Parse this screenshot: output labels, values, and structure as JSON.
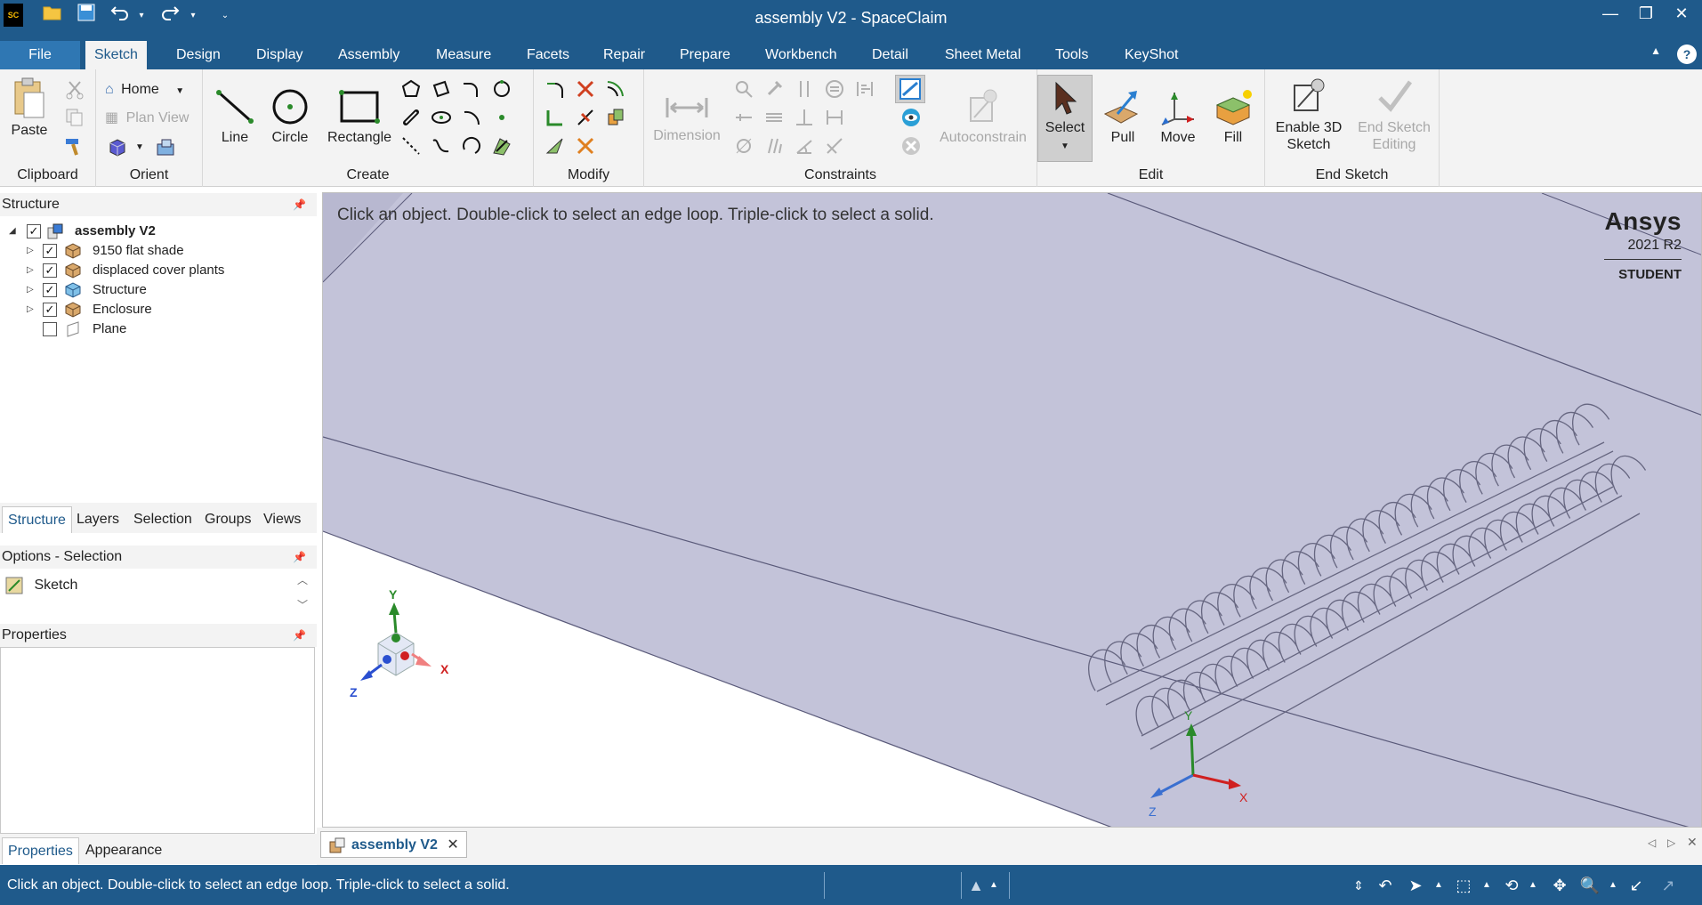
{
  "app": {
    "title": "assembly V2 - SpaceClaim",
    "logo_text": "SC"
  },
  "quick_access": [
    "open-icon",
    "save-icon",
    "undo-icon",
    "redo-icon",
    "customize-icon"
  ],
  "tabs": [
    {
      "label": "File"
    },
    {
      "label": "Sketch"
    },
    {
      "label": "Design"
    },
    {
      "label": "Display"
    },
    {
      "label": "Assembly"
    },
    {
      "label": "Measure"
    },
    {
      "label": "Facets"
    },
    {
      "label": "Repair"
    },
    {
      "label": "Prepare"
    },
    {
      "label": "Workbench"
    },
    {
      "label": "Detail"
    },
    {
      "label": "Sheet Metal"
    },
    {
      "label": "Tools"
    },
    {
      "label": "KeyShot"
    }
  ],
  "ribbon": {
    "clipboard": {
      "name": "Clipboard",
      "paste": "Paste"
    },
    "orient": {
      "name": "Orient",
      "home": "Home",
      "plan_view": "Plan View"
    },
    "create": {
      "name": "Create",
      "line": "Line",
      "circle": "Circle",
      "rectangle": "Rectangle"
    },
    "modify": {
      "name": "Modify"
    },
    "constraints": {
      "name": "Constraints",
      "dimension": "Dimension",
      "autoconstrain": "Autoconstrain"
    },
    "edit": {
      "name": "Edit",
      "select": "Select",
      "pull": "Pull",
      "move": "Move",
      "fill": "Fill"
    },
    "end_sketch": {
      "name": "End Sketch",
      "enable_3d_line1": "Enable 3D",
      "enable_3d_line2": "Sketch",
      "end_edit_line1": "End Sketch",
      "end_edit_line2": "Editing"
    }
  },
  "structure": {
    "header": "Structure",
    "root": "assembly V2",
    "items": [
      {
        "label": "9150 flat shade",
        "checked": true
      },
      {
        "label": "displaced cover plants",
        "checked": true
      },
      {
        "label": "Structure",
        "checked": true
      },
      {
        "label": "Enclosure",
        "checked": true
      },
      {
        "label": "Plane",
        "checked": false
      }
    ]
  },
  "panel_tabs": [
    "Structure",
    "Layers",
    "Selection",
    "Groups",
    "Views"
  ],
  "options": {
    "header": "Options - Selection",
    "item": "Sketch"
  },
  "properties": {
    "header": "Properties",
    "tabs": [
      "Properties",
      "Appearance"
    ]
  },
  "viewport": {
    "hint": "Click an object. Double-click to select an edge loop. Triple-click to select a solid.",
    "brand": "Ansys",
    "version": "2021 R2",
    "edition": "STUDENT",
    "axes": {
      "x": "X",
      "y": "Y",
      "z": "Z"
    }
  },
  "document_tab": {
    "label": "assembly V2"
  },
  "status": {
    "message": "Click an object. Double-click to select an edge loop. Triple-click to select a solid."
  }
}
